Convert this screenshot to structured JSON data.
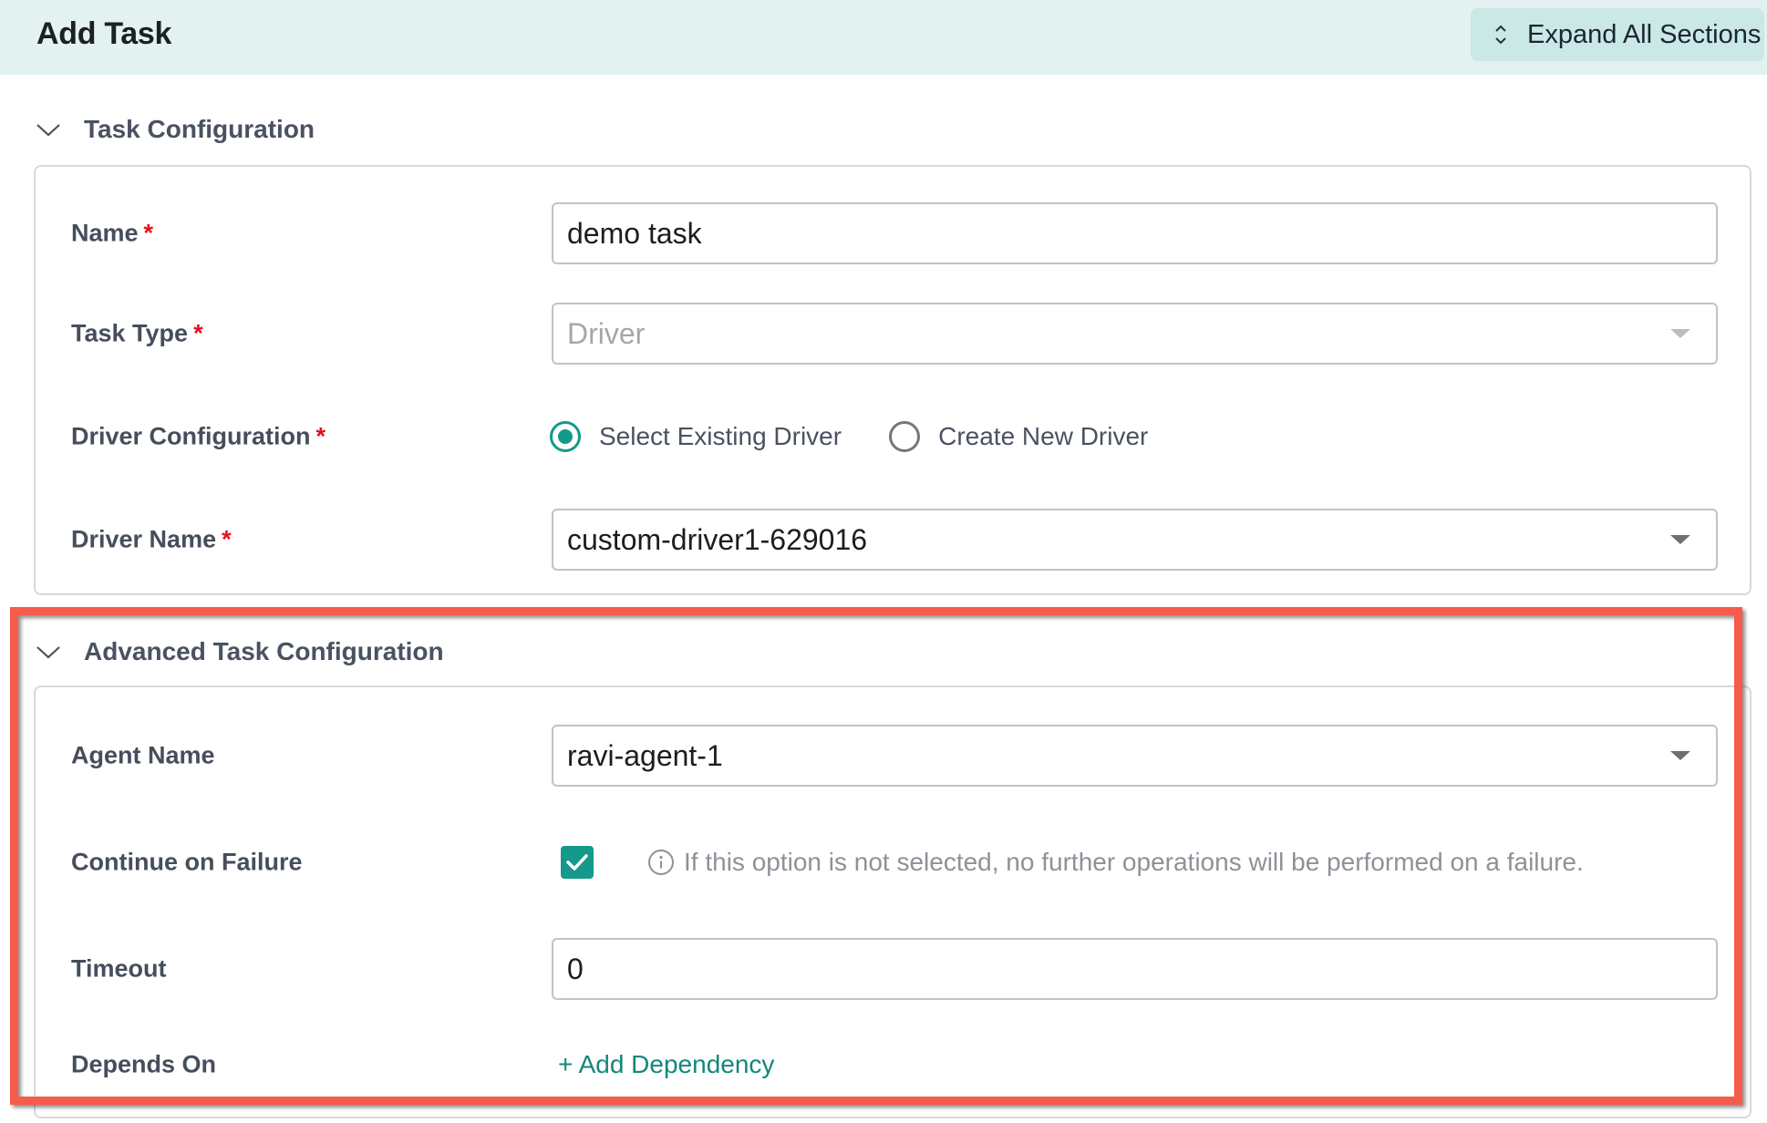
{
  "header": {
    "title": "Add Task",
    "expand_button_label": "Expand All Sections"
  },
  "sections": {
    "task_configuration": {
      "title": "Task Configuration",
      "expanded": true,
      "fields": {
        "name": {
          "label": "Name",
          "required": "*",
          "value": "demo task"
        },
        "task_type": {
          "label": "Task Type",
          "required": "*",
          "value": "Driver",
          "disabled": true
        },
        "driver_configuration": {
          "label": "Driver Configuration",
          "required": "*",
          "options": [
            {
              "label": "Select Existing Driver",
              "selected": true
            },
            {
              "label": "Create New Driver",
              "selected": false
            }
          ]
        },
        "driver_name": {
          "label": "Driver Name",
          "required": "*",
          "value": "custom-driver1-629016"
        }
      }
    },
    "advanced_task_configuration": {
      "title": "Advanced Task Configuration",
      "expanded": true,
      "highlighted": true,
      "fields": {
        "agent_name": {
          "label": "Agent Name",
          "value": "ravi-agent-1"
        },
        "continue_on_failure": {
          "label": "Continue on Failure",
          "checked": true,
          "hint": "If this option is not selected, no further operations will be performed on a failure."
        },
        "timeout": {
          "label": "Timeout",
          "value": "0"
        },
        "depends_on": {
          "label": "Depends On",
          "action_label": "+ Add Dependency"
        }
      }
    }
  },
  "colors": {
    "accent": "#149a88",
    "header_bg": "#e3f2f1",
    "expand_button_bg": "#c9e8e6",
    "required": "#e4101e",
    "highlight": "#f65b4c"
  },
  "icons": {
    "expand": "chevron-up-down-icon",
    "section_toggle": "chevron-down-icon",
    "dropdown": "caret-down-icon",
    "info": "info-icon",
    "check": "checkmark-icon"
  }
}
